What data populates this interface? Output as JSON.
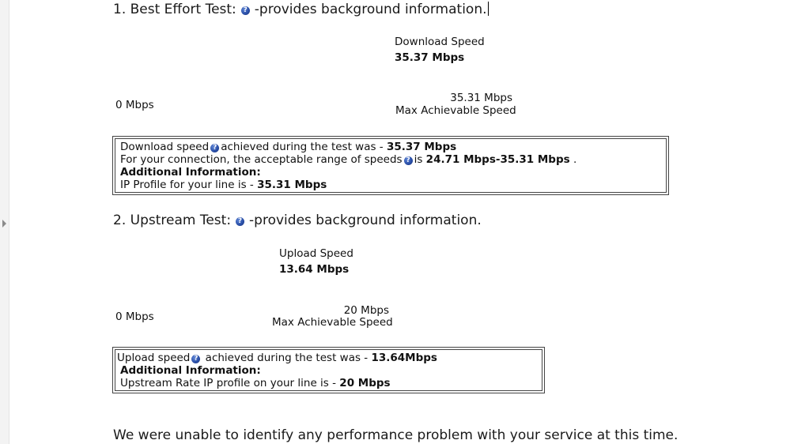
{
  "best_effort": {
    "title": "1. Best Effort Test:",
    "title_suffix": "-provides background information.",
    "gauge_label": "Download Speed",
    "gauge_value": "35.37 Mbps",
    "min_label": "0 Mbps",
    "max_value": "35.31 Mbps",
    "max_label": "Max Achievable Speed",
    "info": {
      "line1_pre": "Download speed",
      "line1_mid": "achieved during the test was - ",
      "line1_val": "35.37 Mbps",
      "line2_pre": "For your connection, the acceptable range of speeds",
      "line2_mid": "is ",
      "line2_val": "24.71 Mbps-35.31 Mbps",
      "line2_end": " .",
      "line3": "Additional Information:",
      "line4_pre": "IP Profile for your line is - ",
      "line4_val": "35.31 Mbps"
    }
  },
  "upstream": {
    "title": "2. Upstream Test:",
    "title_suffix": "-provides background information.",
    "gauge_label": "Upload Speed",
    "gauge_value": "13.64 Mbps",
    "min_label": "0 Mbps",
    "max_value": "20 Mbps",
    "max_label": "Max Achievable Speed",
    "info": {
      "line1_pre": "Upload speed",
      "line1_mid": " achieved during the test was - ",
      "line1_val": "13.64Mbps",
      "line2": "Additional Information:",
      "line3_pre": "Upstream Rate IP profile on your line is - ",
      "line3_val": "20 Mbps"
    }
  },
  "footer": {
    "message": "We were unable to identify any performance problem with your service at this time."
  },
  "icons": {
    "help": "help-question-icon",
    "help_glyph": "?"
  },
  "colors": {
    "help_icon": "#2a4fa8",
    "border": "#444444"
  }
}
